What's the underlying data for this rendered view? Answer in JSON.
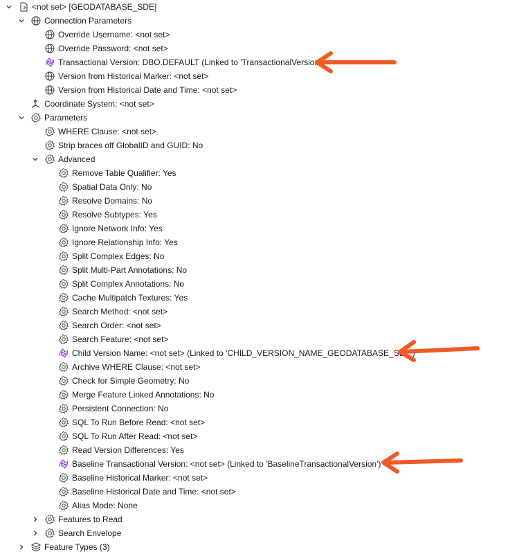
{
  "tree": {
    "root": {
      "label": "<not set> [GEODATABASE_SDE]"
    },
    "connection_parameters": {
      "label": "Connection Parameters",
      "items": [
        {
          "label": "Override Username: <not set>",
          "icon": "globe-icon"
        },
        {
          "label": "Override Password: <not set>",
          "icon": "globe-icon"
        },
        {
          "label": "Transactional Version: DBO.DEFAULT (Linked to 'TransactionalVersion')",
          "icon": "linked-parameter-icon"
        },
        {
          "label": "Version from Historical Marker: <not set>",
          "icon": "globe-icon"
        },
        {
          "label": "Version from Historical Date and Time: <not set>",
          "icon": "globe-icon"
        }
      ]
    },
    "coordinate_system": {
      "label": "Coordinate System: <not set>"
    },
    "parameters": {
      "label": "Parameters",
      "items": [
        {
          "label": "WHERE Clause: <not set>",
          "icon": "gear-icon"
        },
        {
          "label": "Strip braces off GlobalID and GUID: No",
          "icon": "gear-icon"
        }
      ],
      "advanced": {
        "label": "Advanced",
        "items": [
          {
            "label": "Remove Table Qualifier: Yes",
            "icon": "gear-icon"
          },
          {
            "label": "Spatial Data Only: No",
            "icon": "gear-icon"
          },
          {
            "label": "Resolve Domains: No",
            "icon": "gear-icon"
          },
          {
            "label": "Resolve Subtypes: Yes",
            "icon": "gear-icon"
          },
          {
            "label": "Ignore Network Info: Yes",
            "icon": "gear-icon"
          },
          {
            "label": "Ignore Relationship Info: Yes",
            "icon": "gear-icon"
          },
          {
            "label": "Split Complex Edges: No",
            "icon": "gear-icon"
          },
          {
            "label": "Split Multi-Part Annotations: No",
            "icon": "gear-icon"
          },
          {
            "label": "Split Complex Annotations: No",
            "icon": "gear-icon"
          },
          {
            "label": "Cache Multipatch Textures: Yes",
            "icon": "gear-icon"
          },
          {
            "label": "Search Method: <not set>",
            "icon": "gear-icon"
          },
          {
            "label": "Search Order: <not set>",
            "icon": "gear-icon"
          },
          {
            "label": "Search Feature: <not set>",
            "icon": "gear-icon"
          },
          {
            "label": "Child Version Name: <not set> (Linked to 'CHILD_VERSION_NAME_GEODATABASE_SDE')",
            "icon": "linked-parameter-icon"
          },
          {
            "label": "Archive WHERE Clause: <not set>",
            "icon": "gear-icon"
          },
          {
            "label": "Check for Simple Geometry: No",
            "icon": "gear-icon"
          },
          {
            "label": "Merge Feature Linked Annotations: No",
            "icon": "gear-icon"
          },
          {
            "label": "Persistent Connection: No",
            "icon": "gear-icon"
          },
          {
            "label": "SQL To Run Before Read: <not set>",
            "icon": "gear-icon"
          },
          {
            "label": "SQL To Run After Read: <not set>",
            "icon": "gear-icon"
          },
          {
            "label": "Read Version Differences: Yes",
            "icon": "gear-icon"
          },
          {
            "label": "Baseline Transactional Version: <not set> (Linked to 'BaselineTransactionalVersion')",
            "icon": "linked-parameter-icon"
          },
          {
            "label": "Baseline Historical Marker: <not set>",
            "icon": "gear-icon"
          },
          {
            "label": "Baseline Historical Date and Time: <not set>",
            "icon": "gear-icon"
          },
          {
            "label": "Alias Mode: None",
            "icon": "gear-icon"
          }
        ]
      },
      "features_to_read": {
        "label": "Features to Read"
      },
      "search_envelope": {
        "label": "Search Envelope"
      }
    },
    "feature_types": {
      "label": "Feature Types (3)"
    }
  },
  "colors": {
    "annotation_arrow": "#f05a24",
    "linked_icon": "#8b3fd9",
    "text": "#1a1a1a",
    "icon": "#333333"
  }
}
